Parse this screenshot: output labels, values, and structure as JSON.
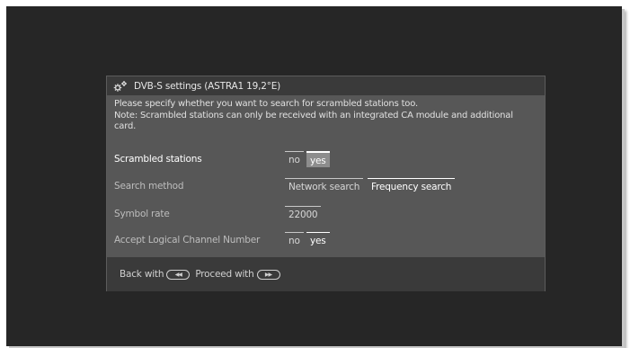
{
  "dialog": {
    "title": "DVB-S settings (ASTRA1 19,2°E)",
    "info_lines": [
      "Please specify whether you want to search for scrambled stations too.",
      "Note: Scrambled stations can only be received with an integrated CA module and additional",
      "card."
    ]
  },
  "settings": {
    "scrambled": {
      "label": "Scrambled stations",
      "options": [
        "no",
        "yes"
      ],
      "selected": "yes"
    },
    "search_method": {
      "label": "Search method",
      "options": [
        "Network search",
        "Frequency search"
      ],
      "selected": "Frequency search"
    },
    "symbol_rate": {
      "label": "Symbol rate",
      "value": "22000"
    },
    "lcn": {
      "label": "Accept Logical Channel Number",
      "options": [
        "no",
        "yes"
      ],
      "selected": "yes"
    }
  },
  "footer": {
    "back_label": "Back with",
    "proceed_label": "Proceed with",
    "back_icon_glyph": "◀◀",
    "proceed_icon_glyph": "▶▶"
  },
  "icons": {
    "title_icon": "gear-icon",
    "back_icon": "rewind-button-icon",
    "proceed_icon": "fast-forward-button-icon"
  }
}
